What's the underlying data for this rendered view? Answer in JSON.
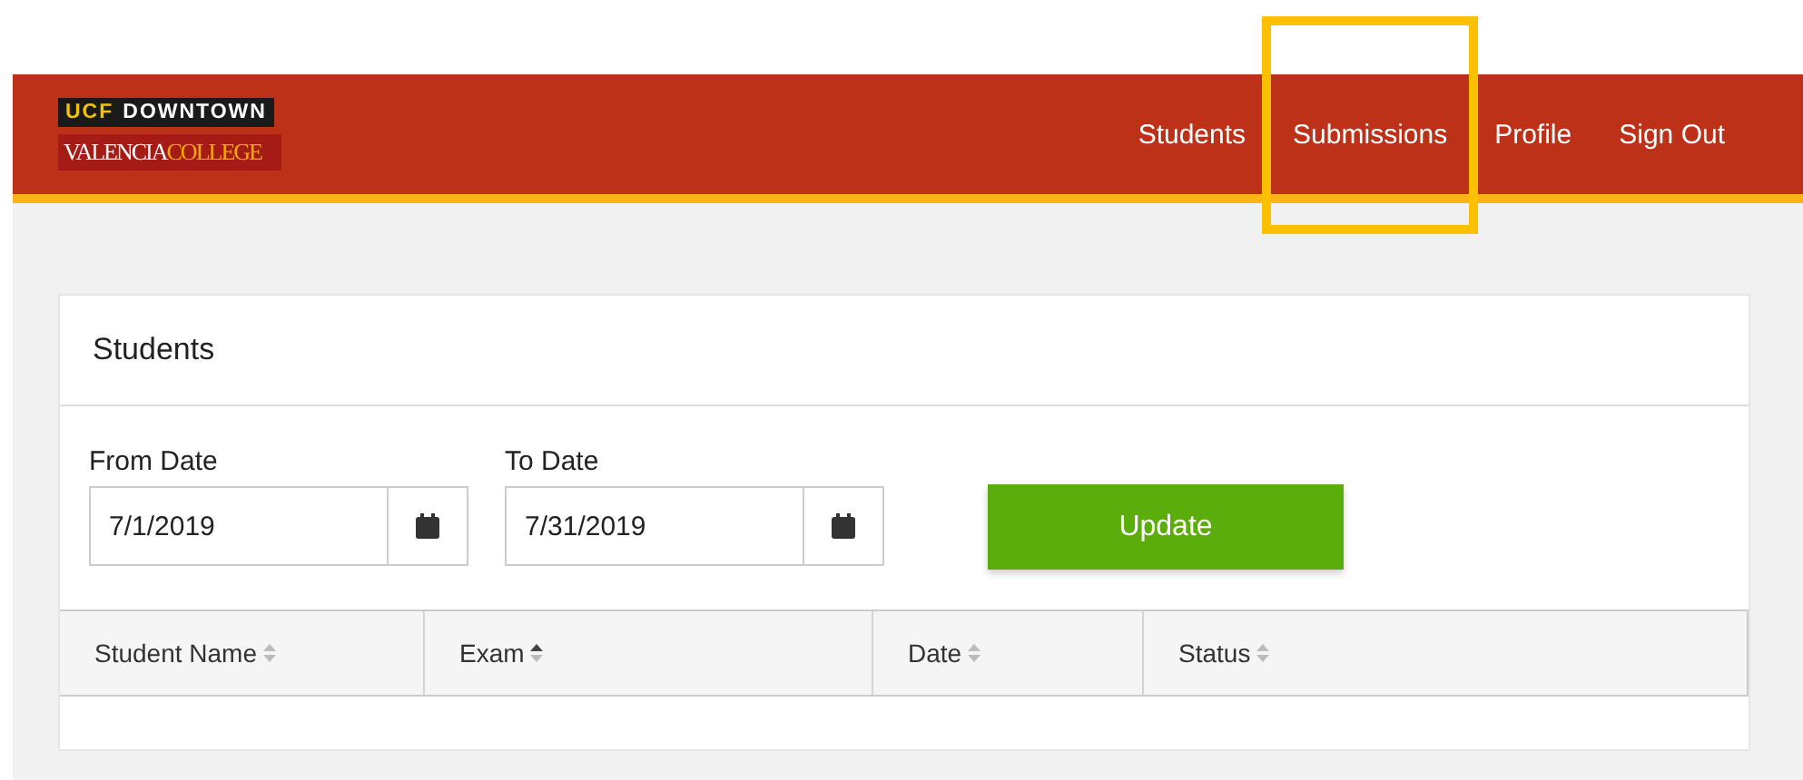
{
  "logo": {
    "line_1": [
      "UCF",
      "DOWNTOWN"
    ],
    "line_2": [
      "VALENCIA",
      "COLLEGE"
    ]
  },
  "nav": [
    {
      "label": "Students",
      "highlighted": false
    },
    {
      "label": "Submissions",
      "highlighted": true
    },
    {
      "label": "Profile",
      "highlighted": false
    },
    {
      "label": "Sign Out",
      "highlighted": false
    }
  ],
  "card": {
    "title": "Students",
    "fields": [
      {
        "label": "From Date",
        "value": "7/1/2019"
      },
      {
        "label": "To Date",
        "value": "7/31/2019"
      }
    ],
    "button": "Update",
    "table": {
      "columns": [
        {
          "label": "Student Name",
          "sorted": false
        },
        {
          "label": "Exam",
          "sorted": true
        },
        {
          "label": "Date",
          "sorted": false
        },
        {
          "label": "Status",
          "sorted": false
        }
      ]
    }
  }
}
